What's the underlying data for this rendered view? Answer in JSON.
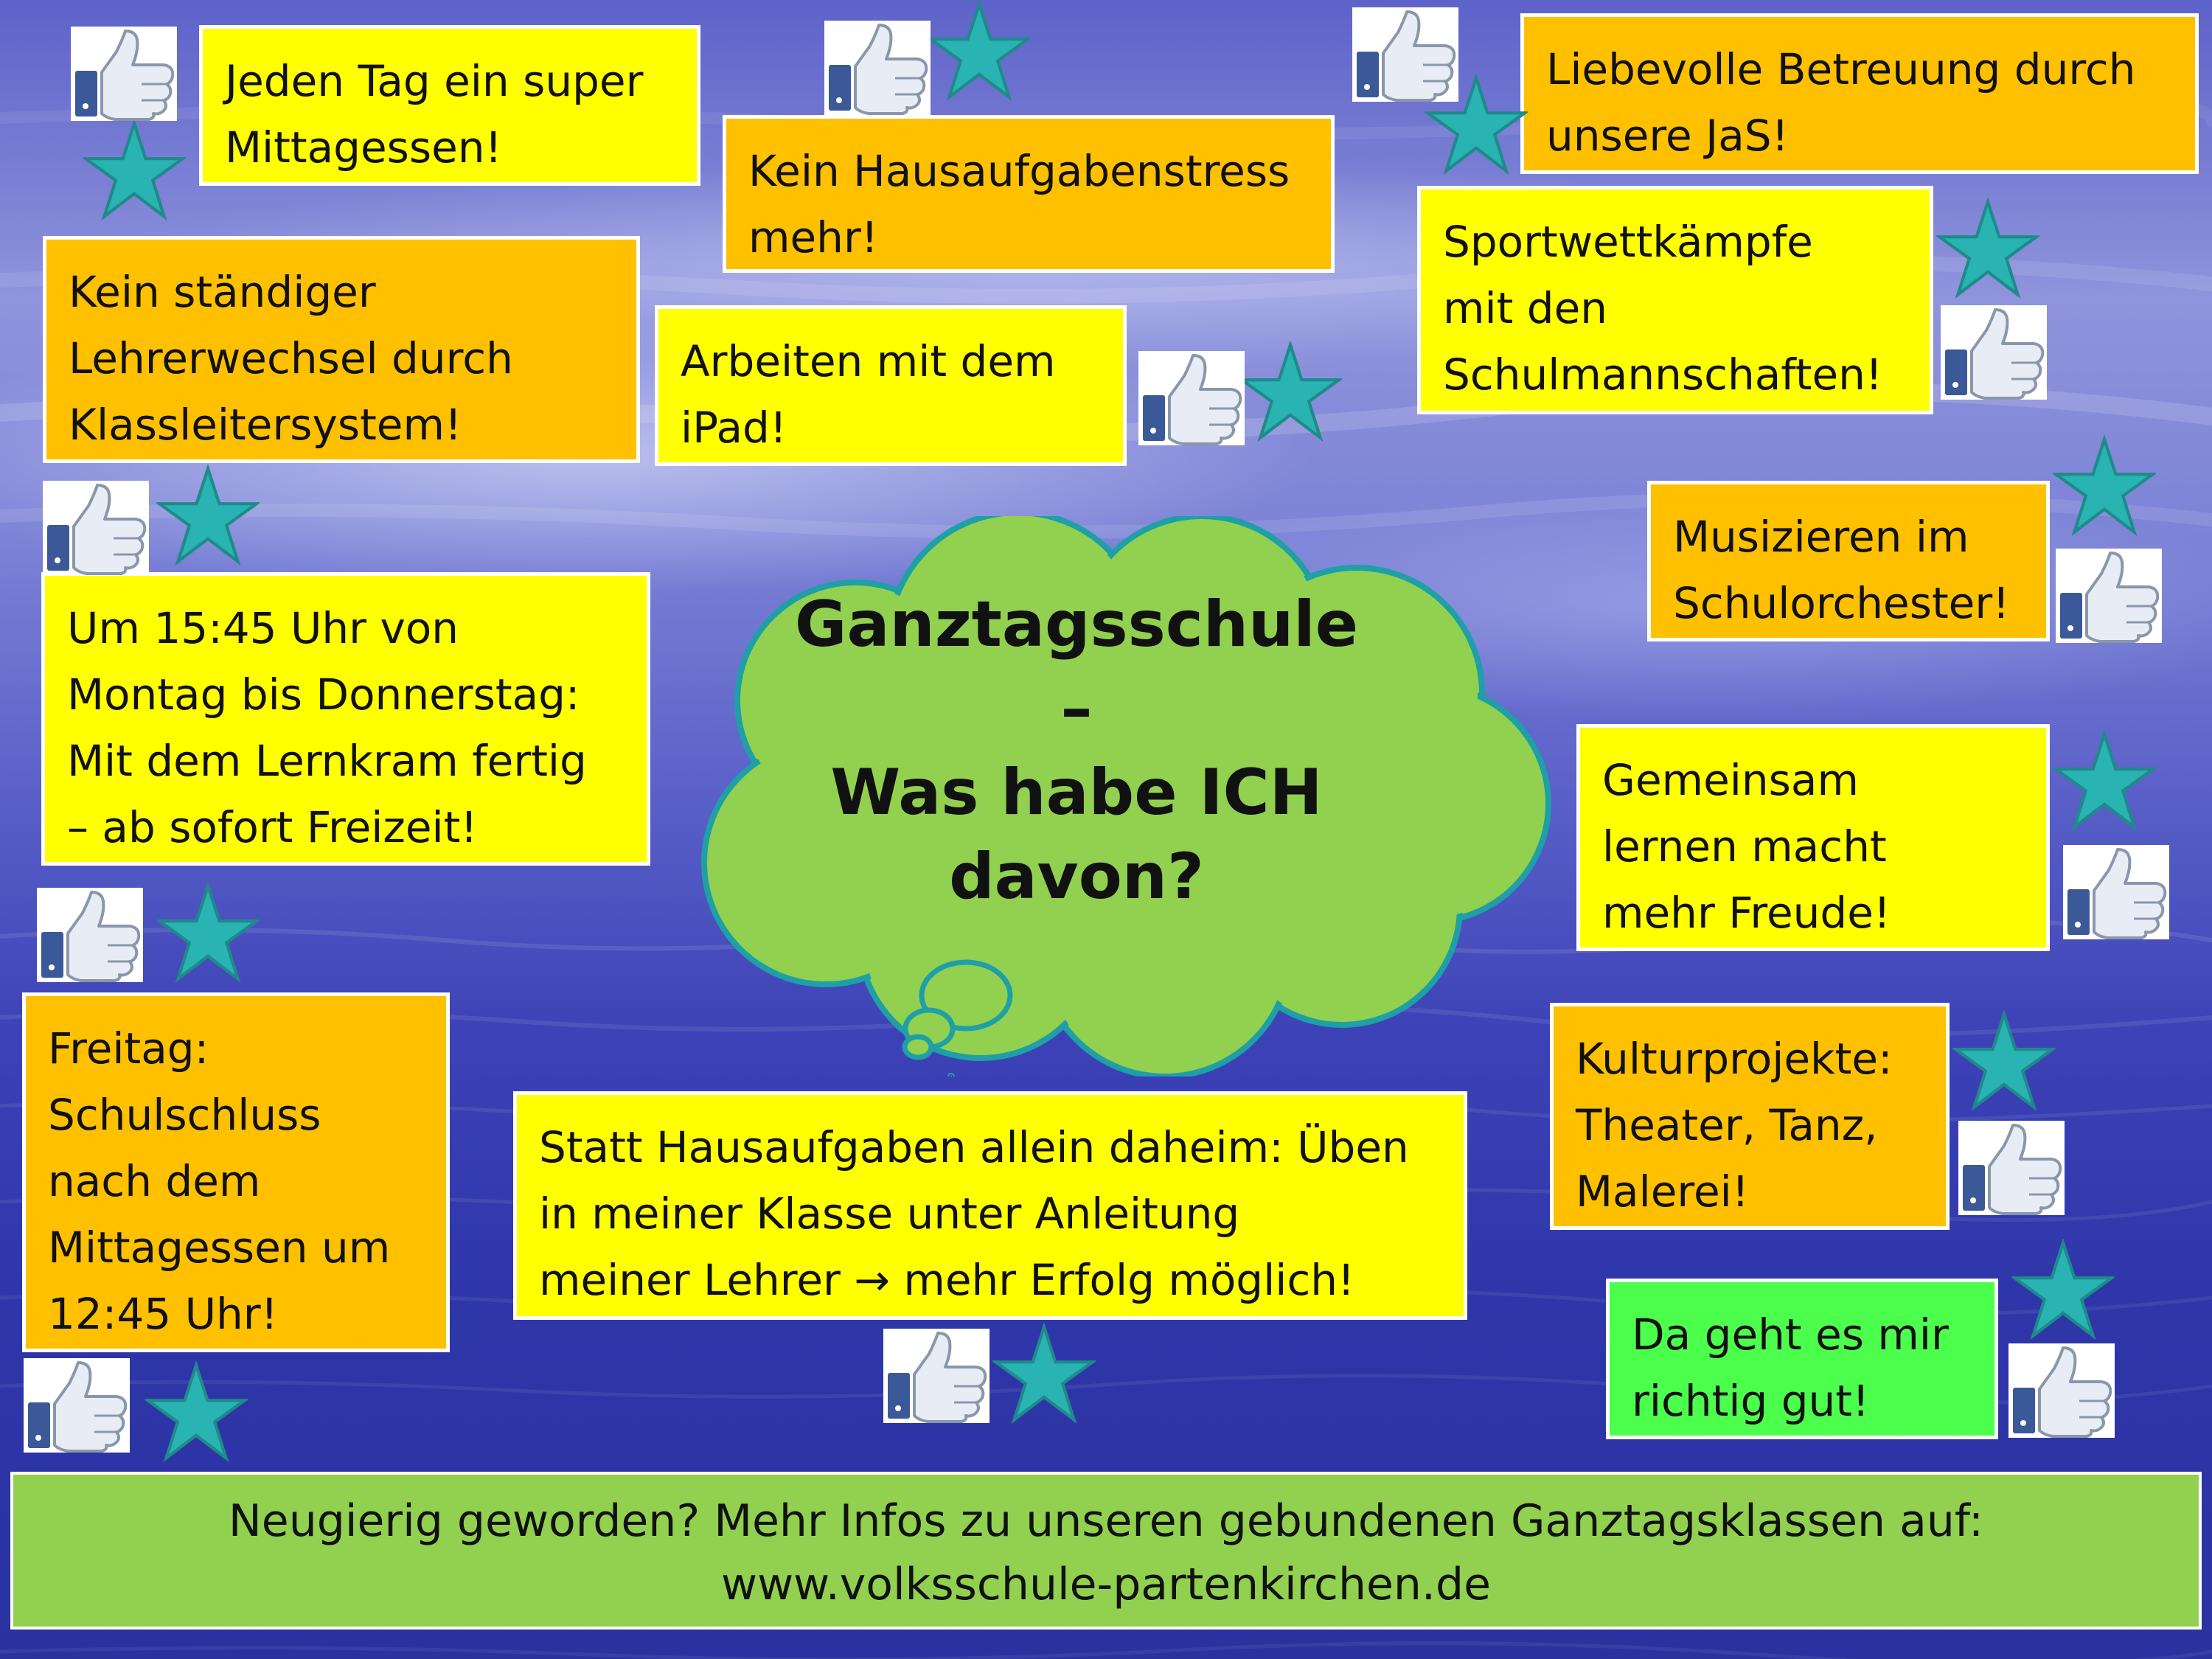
{
  "cloud": {
    "title": "Ganztagsschule\n–\nWas habe ICH\ndavon?"
  },
  "boxes": {
    "mittagessen": "Jeden Tag ein super\nMittagessen!",
    "hausaufgabenstress": "Kein Hausaufgabenstress\nmehr!",
    "betreuung": "Liebevolle Betreuung durch\nunsere JaS!",
    "lehrerwechsel": "Kein ständiger\nLehrerwechsel durch\nKlassleitersystem!",
    "ipad": "Arbeiten mit dem\niPad!",
    "sport": "Sportwettkämpfe\nmit den\nSchulmannschaften!",
    "musik": "Musizieren im\nSchulorchester!",
    "uhrzeit": "Um 15:45 Uhr von\nMontag bis Donnerstag:\nMit dem Lernkram fertig\n– ab sofort Freizeit!",
    "gemeinsam": "Gemeinsam\nlernen macht\nmehr Freude!",
    "freitag": "Freitag:\nSchulschluss\nnach dem\nMittagessen um\n12:45 Uhr!",
    "kultur": "Kulturprojekte:\nTheater, Tanz,\nMalerei!",
    "statt": "Statt Hausaufgaben allein daheim: Üben\nin meiner Klasse unter Anleitung\nmeiner Lehrer → mehr Erfolg möglich!",
    "gut": "Da geht es mir\nrichtig gut!"
  },
  "footer": {
    "text": "Neugierig geworden? Mehr Infos zu unseren gebundenen Ganztagsklassen auf:\nwww.volksschule-partenkirchen.de"
  },
  "icons": {
    "like": "thumbs-up-icon",
    "star": "star-icon"
  },
  "colors": {
    "yellow_box": "#ffff00",
    "orange_box": "#ffc000",
    "green_box": "#4dff4d",
    "cloud_fill": "#92d050",
    "cloud_outline": "#1f9fa6",
    "star_fill": "#29b3b3",
    "thumb_blue": "#3b5998",
    "footer_fill": "#92d050"
  }
}
